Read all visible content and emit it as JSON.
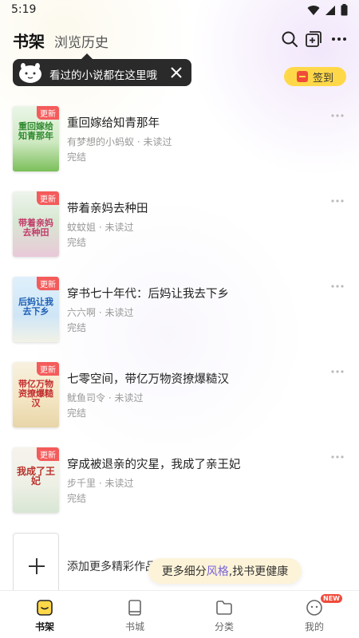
{
  "status_bar": {
    "time": "5:19"
  },
  "header": {
    "tab_shelf": "书架",
    "tab_history": "浏览历史",
    "icons": [
      "search-icon",
      "add-book-icon",
      "more-icon"
    ]
  },
  "tooltip": {
    "text": "看过的小说都在这里哦"
  },
  "signin": {
    "label": "签到"
  },
  "books": [
    {
      "cover_text": "重回嫁给知青那年",
      "badge": "更新",
      "title": "重回嫁给知青那年",
      "meta": "有梦想的小蚂蚁 · 未读过",
      "status": "完结"
    },
    {
      "cover_text": "带着亲妈去种田",
      "badge": "更新",
      "title": "带着亲妈去种田",
      "meta": "蚊蚊姐 · 未读过",
      "status": "完结"
    },
    {
      "cover_text": "后妈让我去下乡",
      "badge": "更新",
      "title": "穿书七十年代：后妈让我去下乡",
      "meta": "六六啊 · 未读过",
      "status": "完结"
    },
    {
      "cover_text": "带亿万物资撩爆糙汉",
      "badge": "更新",
      "title": "七零空间，带亿万物资撩爆糙汉",
      "meta": "鱿鱼司令 · 未读过",
      "status": "完结"
    },
    {
      "cover_text": "我成了王妃",
      "badge": "更新",
      "title": "穿成被退亲的灾星，我成了亲王妃",
      "meta": "步千里 · 未读过",
      "status": "完结"
    }
  ],
  "add_more": {
    "label": "添加更多精彩作品"
  },
  "float_hint": {
    "prefix": "更多细分",
    "highlight": "风格",
    "suffix": ",找书更健康"
  },
  "bottom_nav": [
    {
      "label": "书架",
      "icon": "bookshelf-icon",
      "active": true
    },
    {
      "label": "书城",
      "icon": "book-icon",
      "active": false
    },
    {
      "label": "分类",
      "icon": "folder-icon",
      "active": false
    },
    {
      "label": "我的",
      "icon": "profile-icon",
      "active": false,
      "badge": "NEW"
    }
  ],
  "colors": {
    "accent_yellow": "#ffd84a",
    "badge_red": "#f45b5b",
    "highlight_purple": "#7a63d8"
  }
}
